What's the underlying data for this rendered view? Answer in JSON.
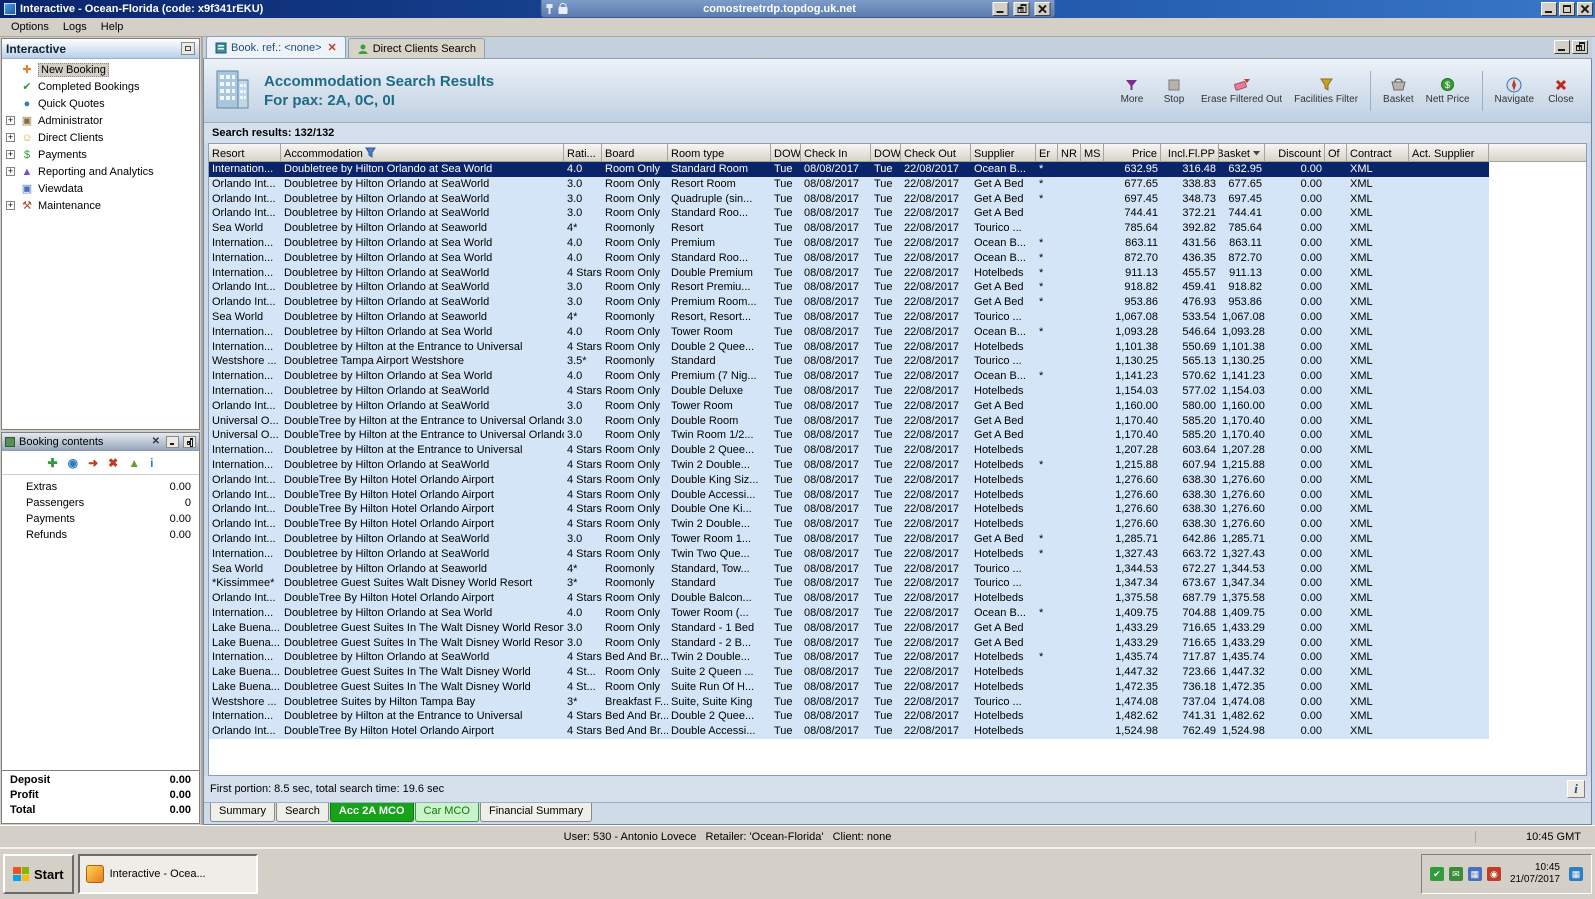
{
  "window": {
    "title": "Interactive - Ocean-Florida (code: x9f341rEKU)",
    "rdp": {
      "host": "comostreetrdp.topdog.uk.net"
    }
  },
  "menu_bar": {
    "items": [
      "Options",
      "Logs",
      "Help"
    ]
  },
  "sidebar": {
    "title": "Interactive",
    "items": [
      {
        "label": "New Booking",
        "icon": "new-booking-icon",
        "glyph": "✚",
        "color": "#d98a2b",
        "expandable": false,
        "selected": true
      },
      {
        "label": "Completed Bookings",
        "icon": "completed-bookings-icon",
        "glyph": "✔",
        "color": "#2e9e3a",
        "expandable": false,
        "selected": false
      },
      {
        "label": "Quick Quotes",
        "icon": "quick-quotes-icon",
        "glyph": "●",
        "color": "#2e7fbf",
        "expandable": false,
        "selected": false
      },
      {
        "label": "Administrator",
        "icon": "administrator-icon",
        "glyph": "▣",
        "color": "#8a6d3b",
        "expandable": true,
        "selected": false
      },
      {
        "label": "Direct Clients",
        "icon": "direct-clients-icon",
        "glyph": "☺",
        "color": "#d9a72b",
        "expandable": true,
        "selected": false
      },
      {
        "label": "Payments",
        "icon": "payments-icon",
        "glyph": "$",
        "color": "#2e9e3a",
        "expandable": true,
        "selected": false
      },
      {
        "label": "Reporting and Analytics",
        "icon": "reporting-icon",
        "glyph": "▲",
        "color": "#7b4fbf",
        "expandable": true,
        "selected": false
      },
      {
        "label": "Viewdata",
        "icon": "viewdata-icon",
        "glyph": "▣",
        "color": "#4a6fbf",
        "expandable": false,
        "selected": false
      },
      {
        "label": "Maintenance",
        "icon": "maintenance-icon",
        "glyph": "⚒",
        "color": "#b04a2b",
        "expandable": true,
        "selected": false
      }
    ]
  },
  "booking_contents": {
    "title": "Booking contents",
    "toolbar": [
      {
        "name": "add-icon",
        "glyph": "✚",
        "color": "#2e9e3a"
      },
      {
        "name": "globe-icon",
        "glyph": "◉",
        "color": "#2e7fbf"
      },
      {
        "name": "transfer-icon",
        "glyph": "➜",
        "color": "#c23b22"
      },
      {
        "name": "delete-icon",
        "glyph": "✖",
        "color": "#c23b22"
      },
      {
        "name": "move-up-icon",
        "glyph": "▲",
        "color": "#6a9e2e"
      },
      {
        "name": "info-icon",
        "glyph": "i",
        "color": "#2e7fbf"
      }
    ],
    "rows": [
      {
        "label": "Extras",
        "value": "0.00"
      },
      {
        "label": "Passengers",
        "value": "0"
      },
      {
        "label": "Payments",
        "value": "0.00"
      },
      {
        "label": "Refunds",
        "value": "0.00"
      }
    ],
    "totals": [
      {
        "label": "Deposit",
        "value": "0.00"
      },
      {
        "label": "Profit",
        "value": "0.00"
      },
      {
        "label": "Total",
        "value": "0.00"
      }
    ]
  },
  "tabs": [
    {
      "label": "Book. ref.: <none>",
      "icon": "book-icon",
      "active": true,
      "closable": true
    },
    {
      "label": "Direct Clients Search",
      "icon": "person-icon",
      "active": false,
      "closable": false
    }
  ],
  "header": {
    "title": "Accommodation Search Results",
    "subtitle": "For pax: 2A, 0C, 0I",
    "buttons": [
      {
        "label": "More",
        "icon": "more-icon",
        "group": 1
      },
      {
        "label": "Stop",
        "icon": "stop-icon",
        "group": 1
      },
      {
        "label": "Erase Filtered Out",
        "icon": "erase-filter-icon",
        "group": 1
      },
      {
        "label": "Facilities Filter",
        "icon": "facilities-filter-icon",
        "group": 1
      },
      {
        "label": "Basket",
        "icon": "basket-icon",
        "group": 2
      },
      {
        "label": "Nett Price",
        "icon": "nett-price-icon",
        "group": 2
      },
      {
        "label": "Navigate",
        "icon": "navigate-icon",
        "group": 3
      },
      {
        "label": "Close",
        "icon": "close-icon",
        "group": 3
      }
    ]
  },
  "results": {
    "summary": "Search results: 132/132",
    "columns": [
      "Resort",
      "Accommodation",
      "Rati...",
      "Board",
      "Room type",
      "DOW",
      "Check In",
      "DOW",
      "Check Out",
      "Supplier",
      "Er",
      "NR",
      "MS",
      "Price",
      "Incl.Fl.PP",
      "Basket",
      "Discount",
      "Of",
      "Contract",
      "Act. Supplier"
    ],
    "header_icons": {
      "1": "filter-funnel-icon",
      "15": "dropdown-arrow-icon"
    },
    "defaults": {
      "dow_in": "Tue",
      "check_in": "08/08/2017",
      "dow_out": "Tue",
      "check_out": "22/08/2017",
      "discount": "0.00",
      "contract": "XML"
    },
    "selected_index": 0,
    "rows": [
      [
        "Internation...",
        "Doubletree by Hilton Orlando at Sea World",
        "4.0",
        "Room Only",
        "Standard Room",
        "Ocean B...",
        "*",
        "632.95",
        "316.48",
        "632.95"
      ],
      [
        "Orlando Int...",
        "Doubletree by Hilton Orlando at SeaWorld",
        "3.0",
        "Room Only",
        "Resort Room",
        "Get A Bed",
        "*",
        "677.65",
        "338.83",
        "677.65"
      ],
      [
        "Orlando Int...",
        "Doubletree by Hilton Orlando at SeaWorld",
        "3.0",
        "Room Only",
        "Quadruple (sin...",
        "Get A Bed",
        "*",
        "697.45",
        "348.73",
        "697.45"
      ],
      [
        "Orlando Int...",
        "Doubletree by Hilton Orlando at SeaWorld",
        "3.0",
        "Room Only",
        "Standard Roo...",
        "Get A Bed",
        "",
        "744.41",
        "372.21",
        "744.41"
      ],
      [
        "Sea World",
        "Doubletree by Hilton Orlando at Seaworld",
        "4*",
        "Roomonly",
        "Resort",
        "Tourico ...",
        "",
        "785.64",
        "392.82",
        "785.64"
      ],
      [
        "Internation...",
        "Doubletree by Hilton Orlando at Sea World",
        "4.0",
        "Room Only",
        "Premium",
        "Ocean B...",
        "*",
        "863.11",
        "431.56",
        "863.11"
      ],
      [
        "Internation...",
        "Doubletree by Hilton Orlando at Sea World",
        "4.0",
        "Room Only",
        "Standard Roo...",
        "Ocean B...",
        "*",
        "872.70",
        "436.35",
        "872.70"
      ],
      [
        "Internation...",
        "Doubletree by Hilton Orlando at SeaWorld",
        "4 Stars",
        "Room Only",
        "Double Premium",
        "Hotelbeds",
        "*",
        "911.13",
        "455.57",
        "911.13"
      ],
      [
        "Orlando Int...",
        "Doubletree by Hilton Orlando at SeaWorld",
        "3.0",
        "Room Only",
        "Resort Premiu...",
        "Get A Bed",
        "*",
        "918.82",
        "459.41",
        "918.82"
      ],
      [
        "Orlando Int...",
        "Doubletree by Hilton Orlando at SeaWorld",
        "3.0",
        "Room Only",
        "Premium Room...",
        "Get A Bed",
        "*",
        "953.86",
        "476.93",
        "953.86"
      ],
      [
        "Sea World",
        "Doubletree by Hilton Orlando at Seaworld",
        "4*",
        "Roomonly",
        "Resort, Resort...",
        "Tourico ...",
        "",
        "1,067.08",
        "533.54",
        "1,067.08"
      ],
      [
        "Internation...",
        "Doubletree by Hilton Orlando at Sea World",
        "4.0",
        "Room Only",
        "Tower Room",
        "Ocean B...",
        "*",
        "1,093.28",
        "546.64",
        "1,093.28"
      ],
      [
        "Internation...",
        "Doubletree by Hilton at the Entrance to Universal",
        "4 Stars",
        "Room Only",
        "Double 2 Quee...",
        "Hotelbeds",
        "",
        "1,101.38",
        "550.69",
        "1,101.38"
      ],
      [
        "Westshore ...",
        "Doubletree Tampa Airport Westshore",
        "3.5*",
        "Roomonly",
        "Standard",
        "Tourico ...",
        "",
        "1,130.25",
        "565.13",
        "1,130.25"
      ],
      [
        "Internation...",
        "Doubletree by Hilton Orlando at Sea World",
        "4.0",
        "Room Only",
        "Premium (7 Nig...",
        "Ocean B...",
        "*",
        "1,141.23",
        "570.62",
        "1,141.23"
      ],
      [
        "Internation...",
        "Doubletree by Hilton Orlando at SeaWorld",
        "4 Stars",
        "Room Only",
        "Double Deluxe",
        "Hotelbeds",
        "",
        "1,154.03",
        "577.02",
        "1,154.03"
      ],
      [
        "Orlando Int...",
        "Doubletree by Hilton Orlando at SeaWorld",
        "3.0",
        "Room Only",
        "Tower Room",
        "Get A Bed",
        "",
        "1,160.00",
        "580.00",
        "1,160.00"
      ],
      [
        "Universal O...",
        "DoubleTree by Hilton at the Entrance to Universal Orlando",
        "3.0",
        "Room Only",
        "Double Room",
        "Get A Bed",
        "",
        "1,170.40",
        "585.20",
        "1,170.40"
      ],
      [
        "Universal O...",
        "DoubleTree by Hilton at the Entrance to Universal Orlando",
        "3.0",
        "Room Only",
        "Twin Room 1/2...",
        "Get A Bed",
        "",
        "1,170.40",
        "585.20",
        "1,170.40"
      ],
      [
        "Internation...",
        "Doubletree by Hilton at the Entrance to Universal",
        "4 Stars",
        "Room Only",
        "Double 2 Quee...",
        "Hotelbeds",
        "",
        "1,207.28",
        "603.64",
        "1,207.28"
      ],
      [
        "Internation...",
        "Doubletree by Hilton Orlando at SeaWorld",
        "4 Stars",
        "Room Only",
        "Twin 2 Double...",
        "Hotelbeds",
        "*",
        "1,215.88",
        "607.94",
        "1,215.88"
      ],
      [
        "Orlando Int...",
        "DoubleTree By Hilton Hotel Orlando Airport",
        "4 Stars",
        "Room Only",
        "Double King Siz...",
        "Hotelbeds",
        "",
        "1,276.60",
        "638.30",
        "1,276.60"
      ],
      [
        "Orlando Int...",
        "DoubleTree By Hilton Hotel Orlando Airport",
        "4 Stars",
        "Room Only",
        "Double Accessi...",
        "Hotelbeds",
        "",
        "1,276.60",
        "638.30",
        "1,276.60"
      ],
      [
        "Orlando Int...",
        "DoubleTree By Hilton Hotel Orlando Airport",
        "4 Stars",
        "Room Only",
        "Double One Ki...",
        "Hotelbeds",
        "",
        "1,276.60",
        "638.30",
        "1,276.60"
      ],
      [
        "Orlando Int...",
        "DoubleTree By Hilton Hotel Orlando Airport",
        "4 Stars",
        "Room Only",
        "Twin 2 Double...",
        "Hotelbeds",
        "",
        "1,276.60",
        "638.30",
        "1,276.60"
      ],
      [
        "Orlando Int...",
        "Doubletree by Hilton Orlando at SeaWorld",
        "3.0",
        "Room Only",
        "Tower Room 1...",
        "Get A Bed",
        "*",
        "1,285.71",
        "642.86",
        "1,285.71"
      ],
      [
        "Internation...",
        "Doubletree by Hilton Orlando at SeaWorld",
        "4 Stars",
        "Room Only",
        "Twin Two Que...",
        "Hotelbeds",
        "*",
        "1,327.43",
        "663.72",
        "1,327.43"
      ],
      [
        "Sea World",
        "Doubletree by Hilton Orlando at Seaworld",
        "4*",
        "Roomonly",
        "Standard, Tow...",
        "Tourico ...",
        "",
        "1,344.53",
        "672.27",
        "1,344.53"
      ],
      [
        "*Kissimmee*",
        "Doubletree Guest Suites Walt Disney World Resort",
        "3*",
        "Roomonly",
        "Standard",
        "Tourico ...",
        "",
        "1,347.34",
        "673.67",
        "1,347.34"
      ],
      [
        "Orlando Int...",
        "DoubleTree By Hilton Hotel Orlando Airport",
        "4 Stars",
        "Room Only",
        "Double Balcon...",
        "Hotelbeds",
        "",
        "1,375.58",
        "687.79",
        "1,375.58"
      ],
      [
        "Internation...",
        "Doubletree by Hilton Orlando at Sea World",
        "4.0",
        "Room Only",
        "Tower Room (...",
        "Ocean B...",
        "*",
        "1,409.75",
        "704.88",
        "1,409.75"
      ],
      [
        "Lake Buena...",
        "Doubletree Guest Suites In The Walt Disney World Resort",
        "3.0",
        "Room Only",
        "Standard - 1 Bed",
        "Get A Bed",
        "",
        "1,433.29",
        "716.65",
        "1,433.29"
      ],
      [
        "Lake Buena...",
        "Doubletree Guest Suites In The Walt Disney World Resort",
        "3.0",
        "Room Only",
        "Standard - 2 B...",
        "Get A Bed",
        "",
        "1,433.29",
        "716.65",
        "1,433.29"
      ],
      [
        "Internation...",
        "Doubletree by Hilton Orlando at SeaWorld",
        "4 Stars",
        "Bed And Br...",
        "Twin 2 Double...",
        "Hotelbeds",
        "*",
        "1,435.74",
        "717.87",
        "1,435.74"
      ],
      [
        "Lake Buena...",
        "Doubletree Guest Suites In The Walt Disney World",
        "4 St...",
        "Room Only",
        "Suite 2 Queen ...",
        "Hotelbeds",
        "",
        "1,447.32",
        "723.66",
        "1,447.32"
      ],
      [
        "Lake Buena...",
        "Doubletree Guest Suites In The Walt Disney World",
        "4 St...",
        "Room Only",
        "Suite Run Of H...",
        "Hotelbeds",
        "",
        "1,472.35",
        "736.18",
        "1,472.35"
      ],
      [
        "Westshore ...",
        "Doubletree Suites by Hilton Tampa Bay",
        "3*",
        "Breakfast F...",
        "Suite, Suite King",
        "Tourico ...",
        "",
        "1,474.08",
        "737.04",
        "1,474.08"
      ],
      [
        "Internation...",
        "Doubletree by Hilton at the Entrance to Universal",
        "4 Stars",
        "Bed And Br...",
        "Double 2 Quee...",
        "Hotelbeds",
        "",
        "1,482.62",
        "741.31",
        "1,482.62"
      ],
      [
        "Orlando Int...",
        "DoubleTree By Hilton Hotel Orlando Airport",
        "4 Stars",
        "Bed And Br...",
        "Double Accessi...",
        "Hotelbeds",
        "",
        "1,524.98",
        "762.49",
        "1,524.98"
      ]
    ],
    "footer": "First portion: 8.5 sec, total search time: 19.6 sec"
  },
  "bottom_tabs": [
    {
      "label": "Summary",
      "style": "plain"
    },
    {
      "label": "Search",
      "style": "plain"
    },
    {
      "label": "Acc 2A MCO",
      "style": "green-dark"
    },
    {
      "label": "Car MCO",
      "style": "green-light"
    },
    {
      "label": "Financial Summary",
      "style": "plain"
    }
  ],
  "status_bar": {
    "user": "User: 530 - Antonio Lovece   Retailer: 'Ocean-Florida'   Client: none",
    "time": "10:45 GMT"
  },
  "taskbar": {
    "start_label": "Start",
    "task_label": "Interactive - Ocea...",
    "tray_icons": [
      {
        "name": "antivirus-shield-icon",
        "glyph": "✔",
        "color": "#2e9e3a"
      },
      {
        "name": "mail-icon",
        "glyph": "✉",
        "color": "#3a8e3a"
      },
      {
        "name": "display-icon",
        "glyph": "▦",
        "color": "#4a6fbf"
      },
      {
        "name": "call-status-icon",
        "glyph": "◉",
        "color": "#c23b22"
      }
    ],
    "clock_time": "10:45",
    "clock_date": "21/07/2017",
    "rdp_tray_icon": {
      "name": "rdp-icon",
      "glyph": "▦",
      "color": "#2e7fbf"
    }
  }
}
